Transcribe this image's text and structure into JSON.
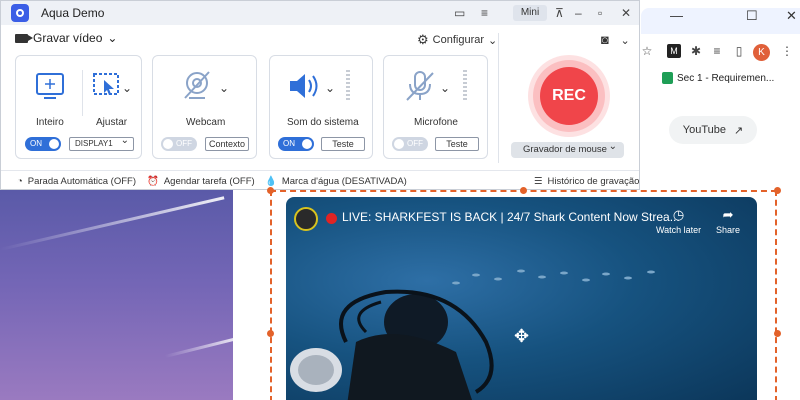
{
  "app": {
    "title": "Aqua Demo",
    "mini_label": "Mini",
    "mode_label": "Gravar vídeo",
    "settings_label": "Configurar",
    "cards": {
      "screen": {
        "label_full": "Inteiro",
        "label_adjust": "Ajustar",
        "toggle": "ON",
        "display": "DISPLAY1"
      },
      "webcam": {
        "label": "Webcam",
        "toggle": "OFF",
        "button": "Contexto"
      },
      "system_sound": {
        "label": "Som do sistema",
        "toggle": "ON",
        "button": "Teste"
      },
      "microphone": {
        "label": "Microfone",
        "toggle": "OFF",
        "button": "Teste"
      }
    },
    "rec_label": "REC",
    "recorder_mode": "Gravador de mouse",
    "status": {
      "auto_stop": "Parada Automática (OFF)",
      "schedule": "Agendar tarefa (OFF)",
      "watermark": "Marca d'água (DESATIVADA)",
      "history": "Histórico de gravação"
    }
  },
  "browser": {
    "bookmark": "Sec 1 - Requiremen...",
    "avatar_letter": "K",
    "youtube_link": "YouTube"
  },
  "video": {
    "title": "LIVE: SHARKFEST IS BACK | 24/7 Shark Content Now Strea...",
    "watch_later": "Watch later",
    "share": "Share"
  },
  "colors": {
    "accent": "#2f6fd8",
    "rec": "#f0454a",
    "capture_border": "#e3622a"
  }
}
